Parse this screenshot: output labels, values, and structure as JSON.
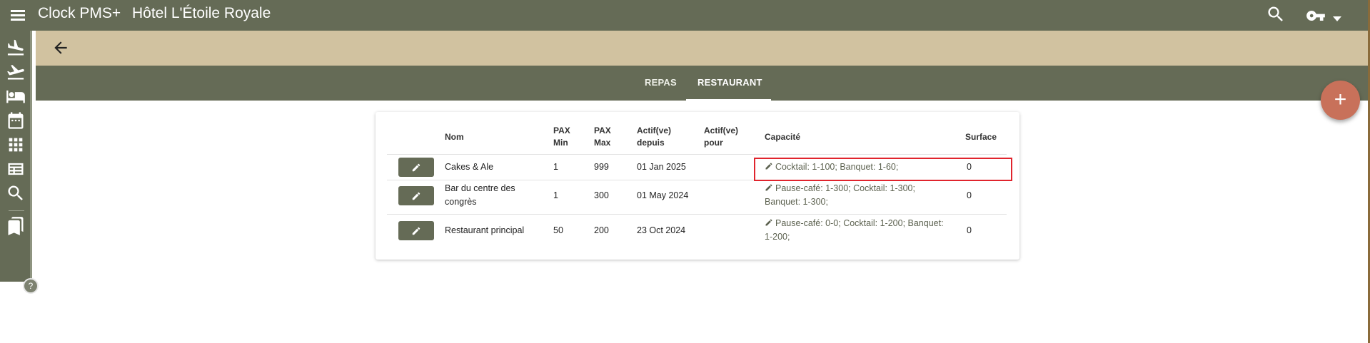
{
  "header": {
    "app_title": "Clock PMS+",
    "hotel_name": "Hôtel L'Étoile Royale"
  },
  "sidebar": {
    "items": [
      {
        "name": "arrivals-icon"
      },
      {
        "name": "departures-icon"
      },
      {
        "name": "rooms-bed-icon"
      },
      {
        "name": "calendar-icon"
      },
      {
        "name": "grid-icon"
      },
      {
        "name": "table-view-icon"
      },
      {
        "name": "search-icon"
      },
      {
        "name": "bookmarks-icon"
      }
    ],
    "help_label": "?"
  },
  "tabs": [
    {
      "label": "REPAS"
    },
    {
      "label": "RESTAURANT",
      "active": true
    }
  ],
  "fab_label": "+",
  "table": {
    "headers": {
      "nom": "Nom",
      "pax_min_1": "PAX",
      "pax_min_2": "Min",
      "pax_max_1": "PAX",
      "pax_max_2": "Max",
      "actif_depuis_1": "Actif(ve)",
      "actif_depuis_2": "depuis",
      "actif_pour_1": "Actif(ve)",
      "actif_pour_2": "pour",
      "capacite": "Capacité",
      "surface": "Surface"
    },
    "rows": [
      {
        "nom": "Cakes & Ale",
        "pax_min": "1",
        "pax_max": "999",
        "actif_depuis": "01 Jan 2025",
        "actif_pour": "",
        "capacite": "Cocktail: 1-100; Banquet: 1-60;",
        "surface": "0"
      },
      {
        "nom_1": "Bar du centre des",
        "nom_2": "congrès",
        "pax_min": "1",
        "pax_max": "300",
        "actif_depuis": "01 May 2024",
        "actif_pour": "",
        "capacite_1": "Pause-café: 1-300; Cocktail: 1-300;",
        "capacite_2": "Banquet: 1-300;",
        "surface": "0"
      },
      {
        "nom": "Restaurant principal",
        "pax_min": "50",
        "pax_max": "200",
        "actif_depuis": "23 Oct 2024",
        "actif_pour": "",
        "capacite_1": "Pause-café: 0-0; Cocktail: 1-200; Banquet:",
        "capacite_2": "1-200;",
        "surface": "0"
      }
    ]
  },
  "colors": {
    "header_bg": "#656b56",
    "subheader_bg": "#d1c2a0",
    "fab_bg": "#c8715a",
    "highlight": "#e0242d"
  }
}
